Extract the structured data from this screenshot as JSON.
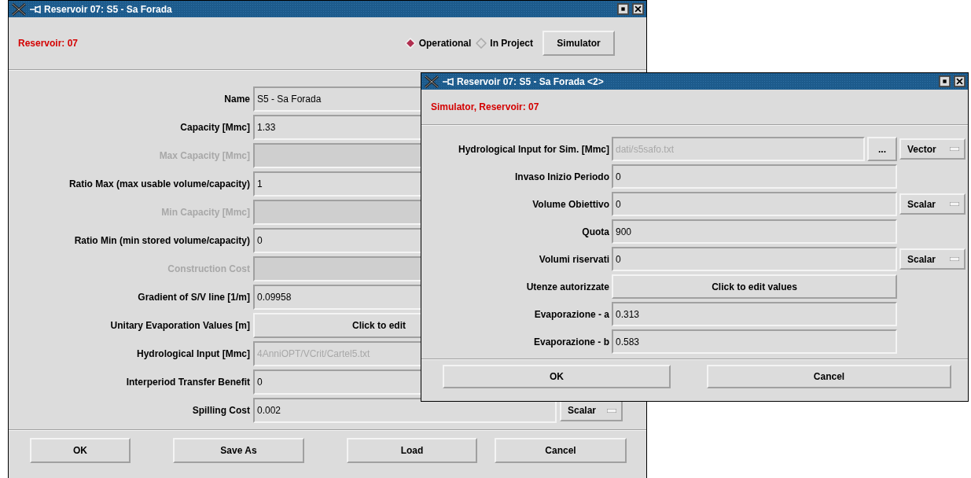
{
  "windows": [
    {
      "title": "Reservoir 07: S5 - Sa Forada",
      "header": "Reservoir: 07",
      "mode_options": [
        {
          "label": "Operational",
          "selected": true
        },
        {
          "label": "In Project",
          "selected": false
        }
      ],
      "header_button": "Simulator",
      "rows": [
        {
          "kind": "field",
          "label": "Name",
          "value": "S5 - Sa Forada",
          "disabled": false,
          "readonly": false
        },
        {
          "kind": "field",
          "label": "Capacity [Mmc]",
          "value": "1.33",
          "disabled": false,
          "readonly": false
        },
        {
          "kind": "field",
          "label": "Max Capacity [Mmc]",
          "disabled": true,
          "readonly": false
        },
        {
          "kind": "field",
          "label": "Ratio Max (max usable volume/capacity)",
          "value": "1",
          "disabled": false,
          "readonly": false
        },
        {
          "kind": "field",
          "label": "Min Capacity [Mmc]",
          "disabled": true,
          "readonly": false
        },
        {
          "kind": "field",
          "label": "Ratio Min (min stored volume/capacity)",
          "value": "0",
          "disabled": false,
          "readonly": false
        },
        {
          "kind": "field",
          "label": "Construction Cost",
          "disabled": true,
          "readonly": false
        },
        {
          "kind": "field",
          "label": "Gradient of S/V line [1/m]",
          "value": "0.09958",
          "disabled": false,
          "readonly": false
        },
        {
          "kind": "button",
          "label": "Unitary Evaporation Values [m]",
          "value": "Click to edit",
          "disabled": false,
          "readonly": false
        },
        {
          "kind": "field",
          "label": "Hydrological Input [Mmc]",
          "value": "4AnniOPT/VCrit/Cartel5.txt",
          "disabled": false,
          "readonly": true
        },
        {
          "kind": "field",
          "label": "Interperiod Transfer Benefit",
          "value": "0",
          "disabled": false,
          "readonly": false
        },
        {
          "kind": "field",
          "label": "Spilling Cost",
          "value": "0.002",
          "disabled": false,
          "readonly": false,
          "dropdown": "Scalar"
        }
      ],
      "buttons": [
        "OK",
        "Save As",
        "Load",
        "Cancel"
      ]
    },
    {
      "title": "Reservoir 07: S5 - Sa Forada <2>",
      "header": "Simulator, Reservoir: 07",
      "rows": [
        {
          "kind": "field",
          "label": "Hydrological Input for Sim. [Mmc]",
          "value": "dati/s5safo.txt",
          "disabled": false,
          "readonly": true,
          "browse": "...",
          "dropdown": "Vector"
        },
        {
          "kind": "field",
          "label": "Invaso Inizio Periodo",
          "value": "0",
          "disabled": false,
          "readonly": false
        },
        {
          "kind": "field",
          "label": "Volume Obiettivo",
          "value": "0",
          "disabled": false,
          "readonly": false,
          "dropdown": "Scalar"
        },
        {
          "kind": "field",
          "label": "Quota",
          "value": "900",
          "disabled": false,
          "readonly": false
        },
        {
          "kind": "field",
          "label": "Volumi riservati",
          "value": "0",
          "disabled": false,
          "readonly": false,
          "dropdown": "Scalar"
        },
        {
          "kind": "button",
          "label": "Utenze autorizzate",
          "value": "Click to edit values",
          "disabled": false,
          "readonly": false
        },
        {
          "kind": "field",
          "label": "Evaporazione - a",
          "value": "0.313",
          "disabled": false,
          "readonly": false
        },
        {
          "kind": "field",
          "label": "Evaporazione - b",
          "value": "0.583",
          "disabled": false,
          "readonly": false
        }
      ],
      "buttons": [
        "OK",
        "Cancel"
      ]
    }
  ]
}
